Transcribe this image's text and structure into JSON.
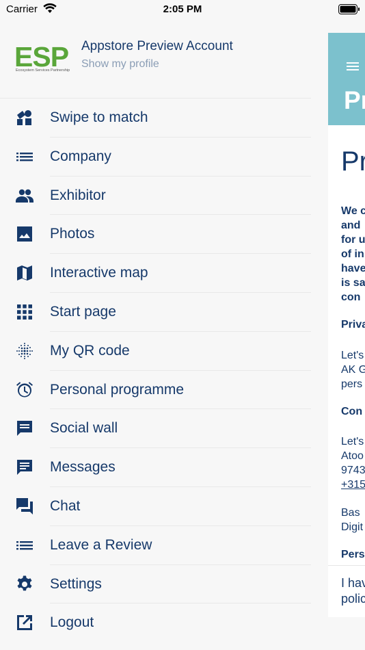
{
  "status_bar": {
    "carrier": "Carrier",
    "time": "2:05 PM"
  },
  "profile": {
    "logo_text": "ESP",
    "logo_subtitle": "Ecosystem Services Partnership",
    "account_name": "Appstore Preview Account",
    "profile_link": "Show my profile"
  },
  "menu": {
    "items": [
      {
        "label": "Swipe to match",
        "icon": "swipe-icon"
      },
      {
        "label": "Company",
        "icon": "list-icon"
      },
      {
        "label": "Exhibitor",
        "icon": "people-icon"
      },
      {
        "label": "Photos",
        "icon": "image-icon"
      },
      {
        "label": "Interactive map",
        "icon": "map-icon"
      },
      {
        "label": "Start page",
        "icon": "grid-icon"
      },
      {
        "label": "My QR code",
        "icon": "qr-dots-icon"
      },
      {
        "label": "Personal programme",
        "icon": "alarm-icon"
      },
      {
        "label": "Social wall",
        "icon": "comment-icon"
      },
      {
        "label": "Messages",
        "icon": "message-icon"
      },
      {
        "label": "Chat",
        "icon": "forum-icon"
      },
      {
        "label": "Leave a Review",
        "icon": "list-icon"
      },
      {
        "label": "Settings",
        "icon": "gear-icon"
      },
      {
        "label": "Logout",
        "icon": "open-in-new-icon"
      }
    ]
  },
  "background_page": {
    "header_title": "Pr",
    "heading": "Pr",
    "bold_block": "We c\nand\nfor u\nof in\nhave\nis sa\ncon",
    "privacy_sub": "Priva",
    "privacy_text": "Let's\nAK G\npers",
    "contact_sub": "Con",
    "contact_text": "Let's\nAtoo\n9743",
    "contact_phone": "+315",
    "person_text": "Bas\nDigit",
    "personal_sub": "Pers",
    "footer_text": "I hav\npolic"
  },
  "colors": {
    "primary": "#16396a",
    "accent_header": "#7cc1cd",
    "logo_green": "#5aa63a",
    "muted_link": "#8a9db5",
    "drawer_bg": "#f7f7f7"
  }
}
